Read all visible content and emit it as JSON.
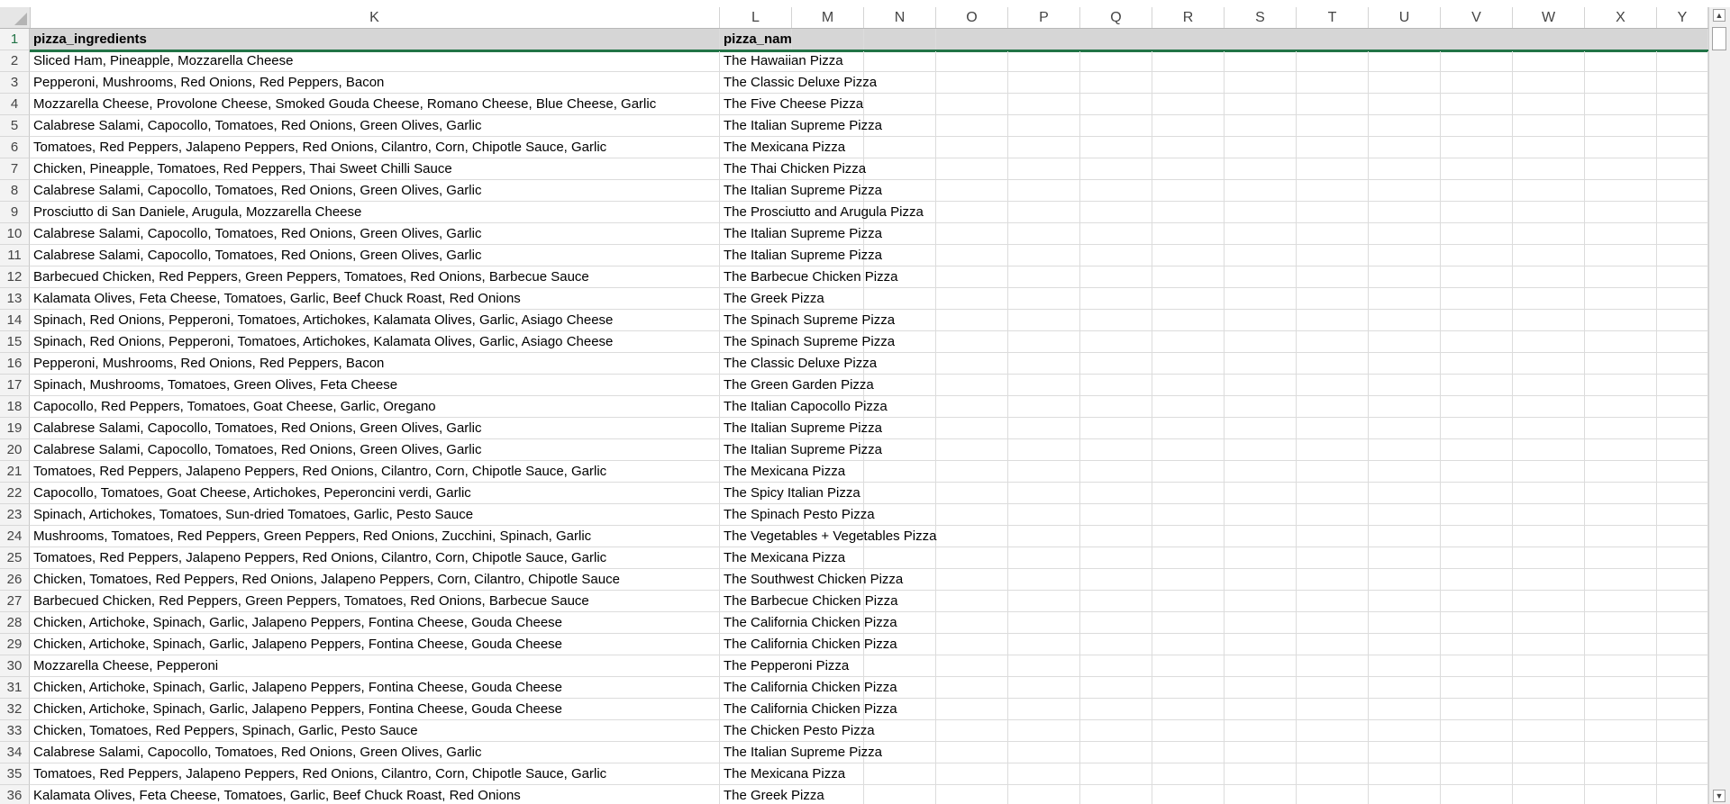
{
  "columns": {
    "letters": [
      "K",
      "L",
      "M",
      "N",
      "O",
      "P",
      "Q",
      "R",
      "S",
      "T",
      "U",
      "V",
      "W",
      "X",
      "Y"
    ]
  },
  "header_row": {
    "row_number": "1",
    "col_k": "pizza_ingredients",
    "col_l": "pizza_name"
  },
  "rows": [
    {
      "n": "2",
      "ingredients": "Sliced Ham, Pineapple, Mozzarella Cheese",
      "name": "The Hawaiian Pizza"
    },
    {
      "n": "3",
      "ingredients": "Pepperoni, Mushrooms, Red Onions, Red Peppers, Bacon",
      "name": "The Classic Deluxe Pizza"
    },
    {
      "n": "4",
      "ingredients": "Mozzarella Cheese, Provolone Cheese, Smoked Gouda Cheese, Romano Cheese, Blue Cheese, Garlic",
      "name": "The Five Cheese Pizza"
    },
    {
      "n": "5",
      "ingredients": "Calabrese Salami, Capocollo, Tomatoes, Red Onions, Green Olives, Garlic",
      "name": "The Italian Supreme Pizza"
    },
    {
      "n": "6",
      "ingredients": "Tomatoes, Red Peppers, Jalapeno Peppers, Red Onions, Cilantro, Corn, Chipotle Sauce, Garlic",
      "name": "The Mexicana Pizza"
    },
    {
      "n": "7",
      "ingredients": "Chicken, Pineapple, Tomatoes, Red Peppers, Thai Sweet Chilli Sauce",
      "name": "The Thai Chicken Pizza"
    },
    {
      "n": "8",
      "ingredients": "Calabrese Salami, Capocollo, Tomatoes, Red Onions, Green Olives, Garlic",
      "name": "The Italian Supreme Pizza"
    },
    {
      "n": "9",
      "ingredients": "Prosciutto di San Daniele, Arugula, Mozzarella Cheese",
      "name": "The Prosciutto and Arugula Pizza"
    },
    {
      "n": "10",
      "ingredients": "Calabrese Salami, Capocollo, Tomatoes, Red Onions, Green Olives, Garlic",
      "name": "The Italian Supreme Pizza"
    },
    {
      "n": "11",
      "ingredients": "Calabrese Salami, Capocollo, Tomatoes, Red Onions, Green Olives, Garlic",
      "name": "The Italian Supreme Pizza"
    },
    {
      "n": "12",
      "ingredients": "Barbecued Chicken, Red Peppers, Green Peppers, Tomatoes, Red Onions, Barbecue Sauce",
      "name": "The Barbecue Chicken Pizza"
    },
    {
      "n": "13",
      "ingredients": "Kalamata Olives, Feta Cheese, Tomatoes, Garlic, Beef Chuck Roast, Red Onions",
      "name": "The Greek Pizza"
    },
    {
      "n": "14",
      "ingredients": "Spinach, Red Onions, Pepperoni, Tomatoes, Artichokes, Kalamata Olives, Garlic, Asiago Cheese",
      "name": "The Spinach Supreme Pizza"
    },
    {
      "n": "15",
      "ingredients": "Spinach, Red Onions, Pepperoni, Tomatoes, Artichokes, Kalamata Olives, Garlic, Asiago Cheese",
      "name": "The Spinach Supreme Pizza"
    },
    {
      "n": "16",
      "ingredients": "Pepperoni, Mushrooms, Red Onions, Red Peppers, Bacon",
      "name": "The Classic Deluxe Pizza"
    },
    {
      "n": "17",
      "ingredients": "Spinach, Mushrooms, Tomatoes, Green Olives, Feta Cheese",
      "name": "The Green Garden Pizza"
    },
    {
      "n": "18",
      "ingredients": "Capocollo, Red Peppers, Tomatoes, Goat Cheese, Garlic, Oregano",
      "name": "The Italian Capocollo Pizza"
    },
    {
      "n": "19",
      "ingredients": "Calabrese Salami, Capocollo, Tomatoes, Red Onions, Green Olives, Garlic",
      "name": "The Italian Supreme Pizza"
    },
    {
      "n": "20",
      "ingredients": "Calabrese Salami, Capocollo, Tomatoes, Red Onions, Green Olives, Garlic",
      "name": "The Italian Supreme Pizza"
    },
    {
      "n": "21",
      "ingredients": "Tomatoes, Red Peppers, Jalapeno Peppers, Red Onions, Cilantro, Corn, Chipotle Sauce, Garlic",
      "name": "The Mexicana Pizza"
    },
    {
      "n": "22",
      "ingredients": "Capocollo, Tomatoes, Goat Cheese, Artichokes, Peperoncini verdi, Garlic",
      "name": "The Spicy Italian Pizza"
    },
    {
      "n": "23",
      "ingredients": "Spinach, Artichokes, Tomatoes, Sun-dried Tomatoes, Garlic, Pesto Sauce",
      "name": "The Spinach Pesto Pizza"
    },
    {
      "n": "24",
      "ingredients": "Mushrooms, Tomatoes, Red Peppers, Green Peppers, Red Onions, Zucchini, Spinach, Garlic",
      "name": "The Vegetables + Vegetables Pizza"
    },
    {
      "n": "25",
      "ingredients": "Tomatoes, Red Peppers, Jalapeno Peppers, Red Onions, Cilantro, Corn, Chipotle Sauce, Garlic",
      "name": "The Mexicana Pizza"
    },
    {
      "n": "26",
      "ingredients": "Chicken, Tomatoes, Red Peppers, Red Onions, Jalapeno Peppers, Corn, Cilantro, Chipotle Sauce",
      "name": "The Southwest Chicken Pizza"
    },
    {
      "n": "27",
      "ingredients": "Barbecued Chicken, Red Peppers, Green Peppers, Tomatoes, Red Onions, Barbecue Sauce",
      "name": "The Barbecue Chicken Pizza"
    },
    {
      "n": "28",
      "ingredients": "Chicken, Artichoke, Spinach, Garlic, Jalapeno Peppers, Fontina Cheese, Gouda Cheese",
      "name": "The California Chicken Pizza"
    },
    {
      "n": "29",
      "ingredients": "Chicken, Artichoke, Spinach, Garlic, Jalapeno Peppers, Fontina Cheese, Gouda Cheese",
      "name": "The California Chicken Pizza"
    },
    {
      "n": "30",
      "ingredients": "Mozzarella Cheese, Pepperoni",
      "name": "The Pepperoni Pizza"
    },
    {
      "n": "31",
      "ingredients": "Chicken, Artichoke, Spinach, Garlic, Jalapeno Peppers, Fontina Cheese, Gouda Cheese",
      "name": "The California Chicken Pizza"
    },
    {
      "n": "32",
      "ingredients": "Chicken, Artichoke, Spinach, Garlic, Jalapeno Peppers, Fontina Cheese, Gouda Cheese",
      "name": "The California Chicken Pizza"
    },
    {
      "n": "33",
      "ingredients": "Chicken, Tomatoes, Red Peppers, Spinach, Garlic, Pesto Sauce",
      "name": "The Chicken Pesto Pizza"
    },
    {
      "n": "34",
      "ingredients": "Calabrese Salami, Capocollo, Tomatoes, Red Onions, Green Olives, Garlic",
      "name": "The Italian Supreme Pizza"
    },
    {
      "n": "35",
      "ingredients": "Tomatoes, Red Peppers, Jalapeno Peppers, Red Onions, Cilantro, Corn, Chipotle Sauce, Garlic",
      "name": "The Mexicana Pizza"
    },
    {
      "n": "36",
      "ingredients": "Kalamata Olives, Feta Cheese, Tomatoes, Garlic, Beef Chuck Roast, Red Onions",
      "name": "The Greek Pizza"
    }
  ],
  "scrollbar": {
    "up_icon": "scroll-up-arrow-icon",
    "down_icon": "scroll-down-arrow-icon"
  },
  "colors": {
    "accent": "#217346",
    "header_fill": "#d6d6d6",
    "gridline": "#dcdcdc"
  }
}
